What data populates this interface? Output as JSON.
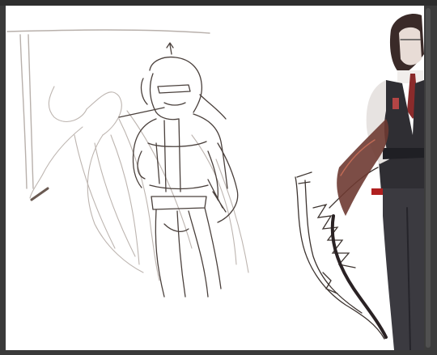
{
  "app": {
    "name": ""
  },
  "canvas": {
    "background": "#ffffff",
    "sketch_colors": {
      "pencil_dark": "#4a403c",
      "pencil_light": "#b8b0ab",
      "accent_red": "#8a2b2b"
    }
  },
  "icons": [
    "sketch-artwork"
  ]
}
